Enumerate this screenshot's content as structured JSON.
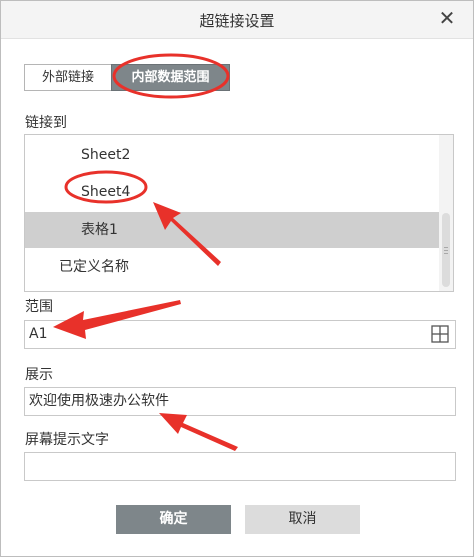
{
  "dialog": {
    "title": "超链接设置",
    "close_glyph": "✕"
  },
  "tabs": [
    {
      "label": "外部链接",
      "active": false
    },
    {
      "label": "内部数据范围",
      "active": true
    }
  ],
  "link_to": {
    "label": "链接到",
    "items": [
      {
        "label": "Sheet2",
        "selected": false
      },
      {
        "label": "Sheet4",
        "selected": false
      },
      {
        "label": "表格1",
        "selected": true
      },
      {
        "label": "已定义名称",
        "selected": false
      }
    ]
  },
  "range": {
    "label": "范围",
    "value": "A1",
    "picker_icon": "grid-icon"
  },
  "display": {
    "label": "展示",
    "value": "欢迎使用极速办公软件"
  },
  "tooltip": {
    "label": "屏幕提示文字",
    "value": ""
  },
  "buttons": {
    "ok": "确定",
    "cancel": "取消"
  },
  "colors": {
    "accent": "#7e868a",
    "annotation": "#e8312a",
    "selected_row": "#cfcfcf"
  }
}
